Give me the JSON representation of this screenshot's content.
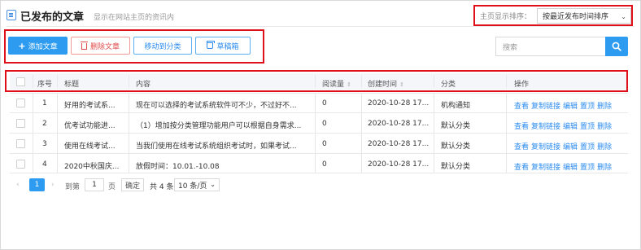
{
  "header": {
    "title": "已发布的文章",
    "subtitle": "显示在网站主页的资讯内"
  },
  "sort": {
    "label": "主页显示排序：",
    "value": "按最近发布时间排序",
    "caret": "⌄"
  },
  "toolbar": {
    "add_plus": "+",
    "add_label": "添加文章",
    "delete_label": "删除文章",
    "move_label": "移动到分类",
    "draft_label": "草稿箱"
  },
  "search": {
    "placeholder": "搜索"
  },
  "table": {
    "columns": {
      "index": "序号",
      "title": "标题",
      "content": "内容",
      "views": "阅读量",
      "created": "创建时间",
      "category": "分类",
      "actions": "操作"
    },
    "sort_glyph": "⇕",
    "rows": [
      {
        "index": "1",
        "title": "好用的考试系...",
        "content": "现在可以选择的考试系统软件可不少，不过好不...",
        "views": "0",
        "created": "2020-10-28 17...",
        "category": "机构通知"
      },
      {
        "index": "2",
        "title": "优考试功能进...",
        "content": "（1）增加按分类管理功能用户可以根据自身需求...",
        "views": "0",
        "created": "2020-10-28 17...",
        "category": "默认分类"
      },
      {
        "index": "3",
        "title": "使用在线考试...",
        "content": "当我们使用在线考试系统组织考试时，如果考试...",
        "views": "0",
        "created": "2020-10-28 17...",
        "category": "默认分类"
      },
      {
        "index": "4",
        "title": "2020中秋国庆...",
        "content": "放假时间：10.01.-10.08",
        "views": "0",
        "created": "2020-10-28 17...",
        "category": "默认分类"
      }
    ],
    "actions": {
      "view": "查看",
      "copy_link": "复制链接",
      "edit": "编辑",
      "pin": "置顶",
      "delete": "删除"
    }
  },
  "pagination": {
    "prev": "‹",
    "current": "1",
    "next": "›",
    "goto_label": "到第",
    "goto_value": "1",
    "page_label": "页",
    "confirm_label": "确定",
    "total": "共 4 条",
    "page_size": "10 条/页",
    "caret": "⌄"
  },
  "colors": {
    "accent": "#2d9cf0",
    "danger": "#e24a4a",
    "highlight_box": "#e0101a"
  }
}
